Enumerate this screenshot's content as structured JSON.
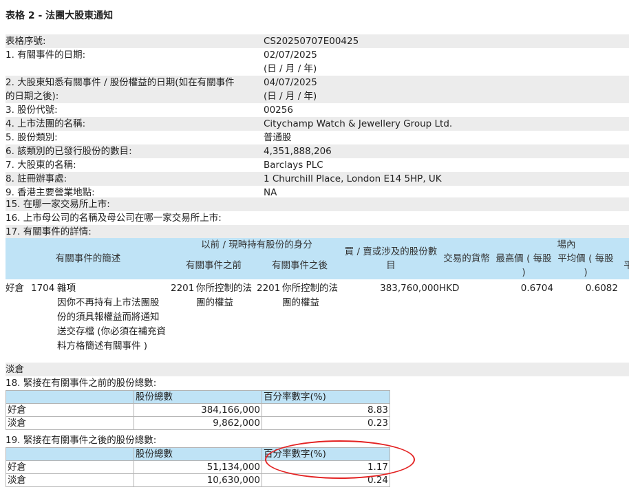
{
  "title": "表格 2 - 法團大股東通知",
  "fields": [
    {
      "k": "表格序號:",
      "v": "CS20250707E00425"
    },
    {
      "k": "1. 有關事件的日期:",
      "v": "02/07/2025",
      "sub": "(日 / 月 / 年)"
    },
    {
      "k": "2. 大股東知悉有關事件 / 股份權益的日期(如在有關事件",
      "k2": "的日期之後):",
      "v": "04/07/2025",
      "sub": "(日 / 月 / 年)"
    },
    {
      "k": "3. 股份代號:",
      "v": "00256"
    },
    {
      "k": "4. 上市法團的名稱:",
      "v": "Citychamp Watch & Jewellery Group Ltd."
    },
    {
      "k": "5. 股份類別:",
      "v": "普通股"
    },
    {
      "k": "6. 該類別的已發行股份的數目:",
      "v": "4,351,888,206"
    },
    {
      "k": "7. 大股東的名稱:",
      "v": "Barclays PLC"
    },
    {
      "k": "8. 註冊辦事處:",
      "v": "1 Churchill Place, London E14 5HP, UK"
    },
    {
      "k": "9. 香港主要營業地點:",
      "v": "NA"
    }
  ],
  "q15": "15. 在哪一家交易所上市:",
  "q16": "16. 上市母公司的名稱及母公司在哪一家交易所上市:",
  "q17": "17. 有關事件的詳情:",
  "event_headers": {
    "desc": "有關事件的簡述",
    "capacity": "以前 / 現時持有股份的身分",
    "before": "有關事件之前",
    "after": "有關事件之後",
    "shares": "買 / 賣或涉及的股份數目",
    "currency": "交易的貨幣",
    "onexchange": "場內",
    "high": "最高價 ( 每股 )",
    "avg": "平均價 ( 每股 )",
    "more": "平"
  },
  "event": {
    "position": "好倉",
    "code": "1704",
    "desc": "雜項",
    "desc_detail": "因你不再持有上市法團股份的須具報權益而將通知送交存檔 (你必須在補充資料方格簡述有關事件 )",
    "before_code": "2201",
    "before_text": "你所控制的法團的權益",
    "after_code": "2201",
    "after_text": "你所控制的法團的權益",
    "shares": "383,760,000",
    "currency": "HKD",
    "high": "0.6704",
    "avg": "0.6082"
  },
  "short_label": "淡倉",
  "q18": "18. 緊接在有關事件之前的股份總數:",
  "q19": "19. 緊接在有關事件之後的股份總數:",
  "sum_headers": {
    "shares": "股份總數",
    "pct": "百分率數字(%)"
  },
  "before_rows": [
    {
      "label": "好倉",
      "shares": "384,166,000",
      "pct": "8.83"
    },
    {
      "label": "淡倉",
      "shares": "9,862,000",
      "pct": "0.23"
    }
  ],
  "after_rows": [
    {
      "label": "好倉",
      "shares": "51,134,000",
      "pct": "1.17"
    },
    {
      "label": "淡倉",
      "shares": "10,630,000",
      "pct": "0.24"
    }
  ],
  "annotation_color": "#e32222",
  "header_color": "#bfe3f6"
}
